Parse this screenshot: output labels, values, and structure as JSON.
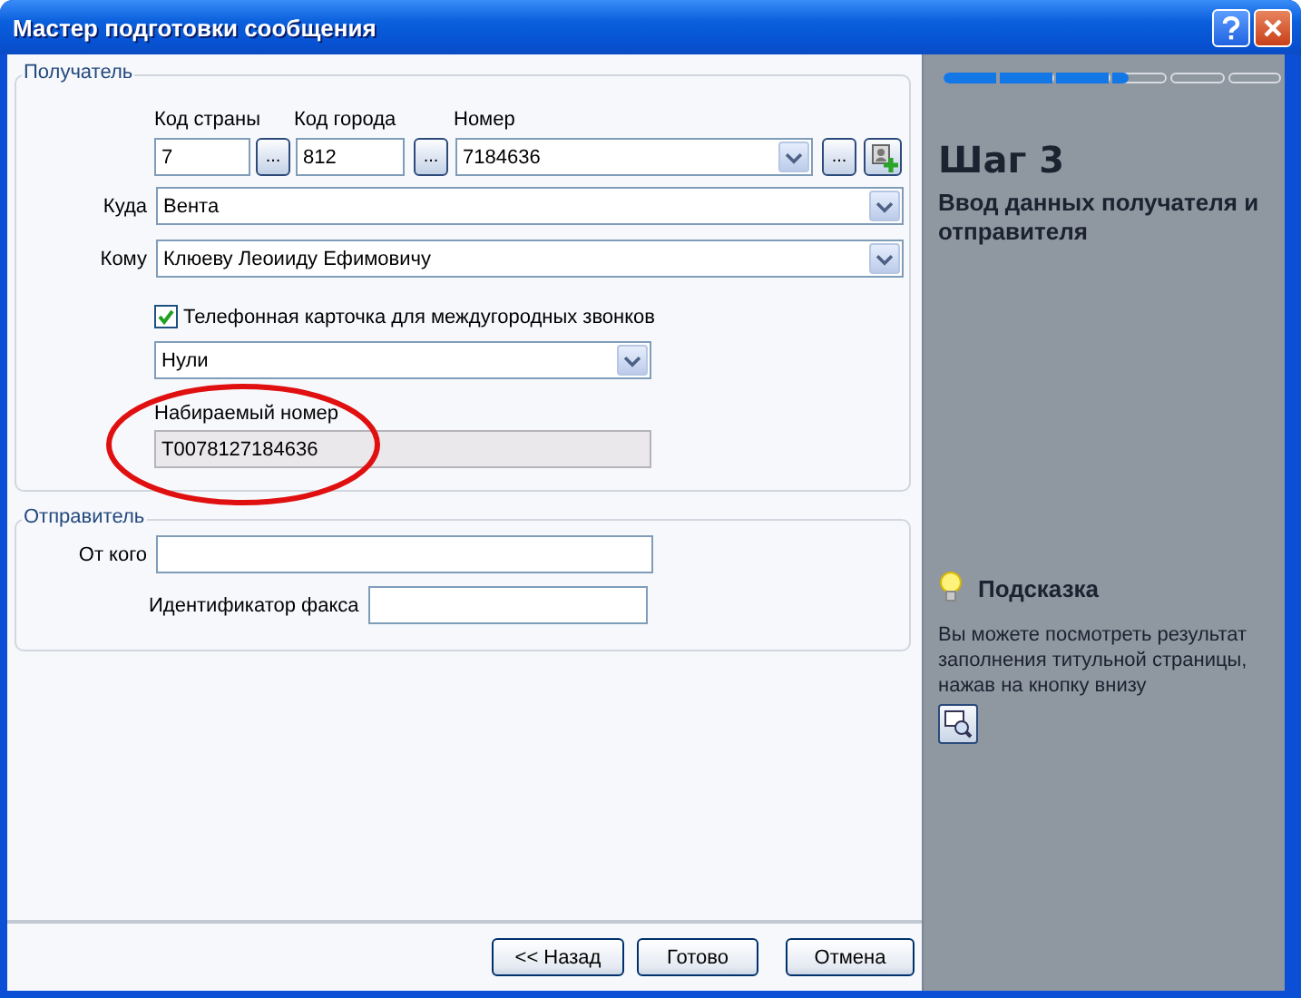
{
  "window": {
    "title": "Мастер подготовки сообщения"
  },
  "recipient": {
    "legend": "Получатель",
    "country_code": {
      "label": "Код страны",
      "value": "7",
      "button": "..."
    },
    "city_code": {
      "label": "Код города",
      "value": "812",
      "button": "..."
    },
    "number": {
      "label": "Номер",
      "value": "7184636",
      "button": "..."
    },
    "destination": {
      "label": "Куда",
      "value": "Вента"
    },
    "addressee": {
      "label": "Кому",
      "value": "Клюеву Леоииду Ефимовичу"
    },
    "calling_card": {
      "label": "Телефонная карточка для междугородных звонков",
      "checked": true,
      "value": "Нули"
    },
    "dialed_number": {
      "label": "Набираемый номер",
      "value": "T0078127184636",
      "disabled": true
    }
  },
  "sender": {
    "legend": "Отправитель",
    "from": {
      "label": "От кого"
    },
    "fax_id": {
      "label": "Идентификатор факса"
    }
  },
  "buttons": [
    {
      "label": "<< Назад"
    },
    {
      "label": "Готово"
    },
    {
      "label": "Отмена"
    }
  ],
  "step": {
    "progress": {
      "level": 0.55
    },
    "title": "Шаг 3",
    "description": "Ввод данных получателя и отправителя"
  },
  "hint": {
    "title": "Подсказка",
    "text": "Вы можете посмотреть результат заполнения титульной страницы, нажав на кнопку внизу"
  }
}
